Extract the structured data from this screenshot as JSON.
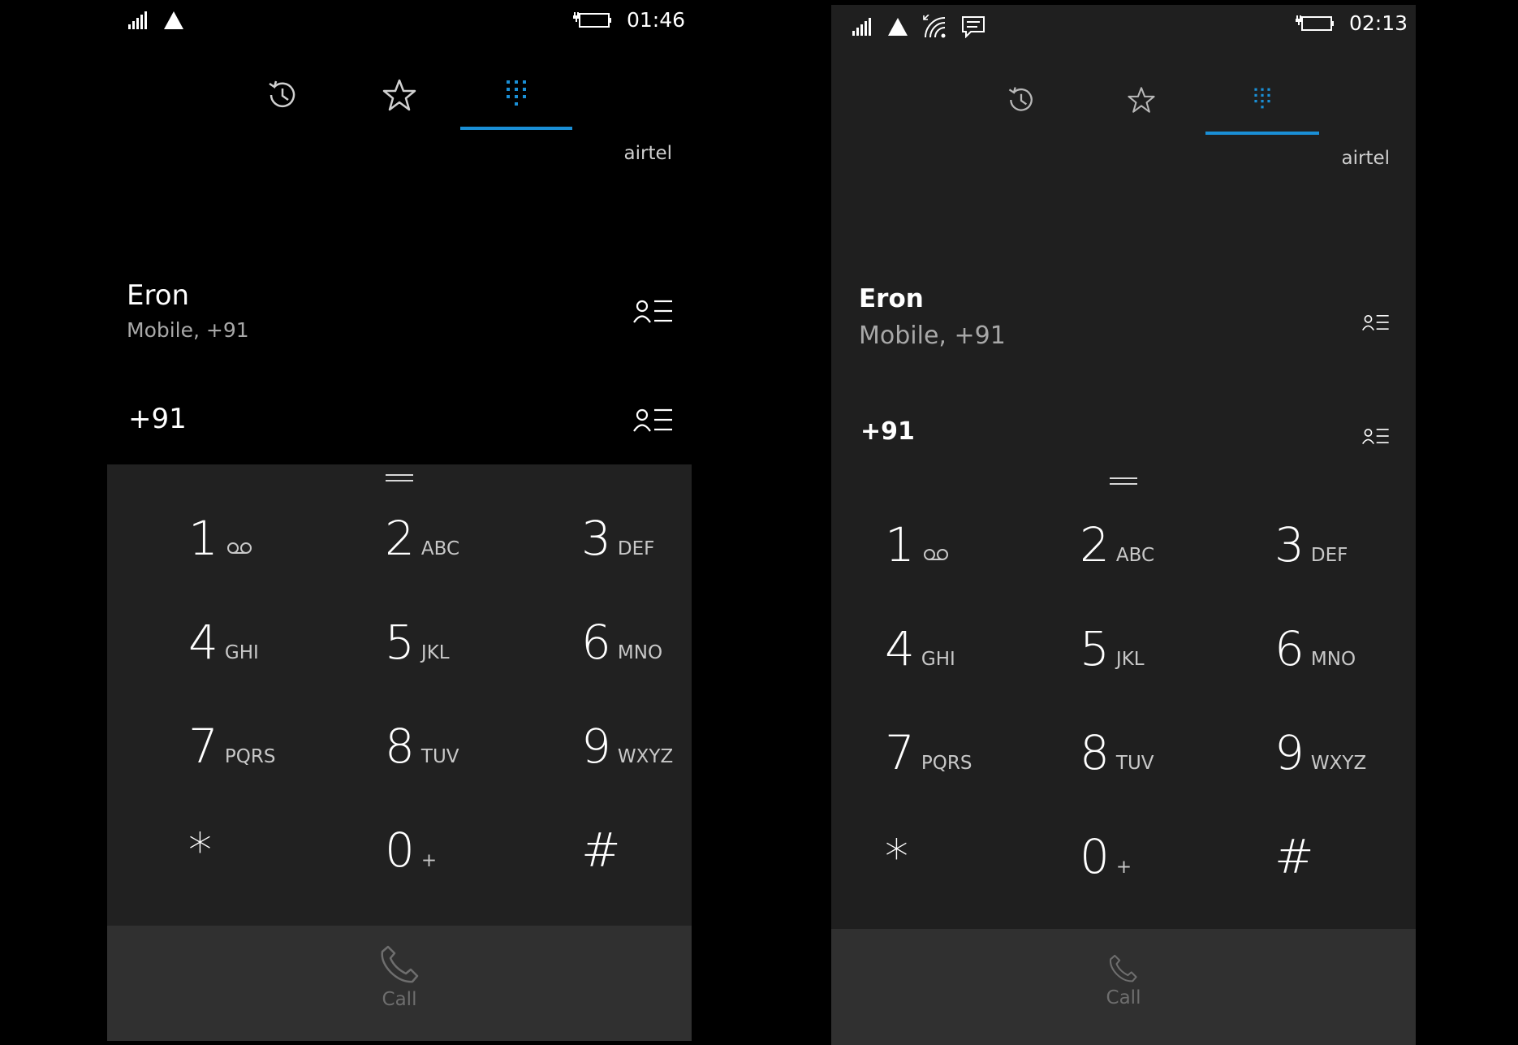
{
  "colors": {
    "accent": "#1a8fd6",
    "left_background": "#000000",
    "right_background": "#1f1f1f",
    "keypad_background": "#212121",
    "callbar_background": "#303030",
    "secondary_text": "#a8a8a8",
    "disabled_text": "#6e6e6e"
  },
  "left": {
    "status": {
      "time": "01:46",
      "icons": [
        "signal-strength-icon",
        "roaming-triangle-icon",
        "battery-charging-icon"
      ]
    },
    "tabs": [
      {
        "name": "history",
        "icon": "history-icon"
      },
      {
        "name": "speed-dial",
        "icon": "star-icon"
      },
      {
        "name": "keypad",
        "icon": "dialpad-icon",
        "selected": true
      }
    ],
    "carrier": "airtel",
    "suggestion": {
      "name": "Eron",
      "detail": "Mobile, +91"
    },
    "entry": {
      "number": "+91"
    },
    "keys": [
      {
        "digit": "1",
        "letters": "",
        "icon": "voicemail-icon"
      },
      {
        "digit": "2",
        "letters": "ABC"
      },
      {
        "digit": "3",
        "letters": "DEF"
      },
      {
        "digit": "4",
        "letters": "GHI"
      },
      {
        "digit": "5",
        "letters": "JKL"
      },
      {
        "digit": "6",
        "letters": "MNO"
      },
      {
        "digit": "7",
        "letters": "PQRS"
      },
      {
        "digit": "8",
        "letters": "TUV"
      },
      {
        "digit": "9",
        "letters": "WXYZ"
      },
      {
        "digit": "*",
        "letters": ""
      },
      {
        "digit": "0",
        "letters": "+"
      },
      {
        "digit": "#",
        "letters": ""
      }
    ],
    "call": {
      "label": "Call",
      "enabled": false
    }
  },
  "right": {
    "status": {
      "time": "02:13",
      "icons": [
        "signal-strength-icon",
        "roaming-triangle-icon",
        "wifi-calling-icon",
        "message-icon",
        "battery-charging-icon"
      ]
    },
    "tabs": [
      {
        "name": "history",
        "icon": "history-icon"
      },
      {
        "name": "speed-dial",
        "icon": "star-icon"
      },
      {
        "name": "keypad",
        "icon": "dialpad-icon",
        "selected": true
      }
    ],
    "carrier": "airtel",
    "suggestion": {
      "name": "Eron",
      "detail": "Mobile, +91"
    },
    "entry": {
      "number": "+91"
    },
    "keys": [
      {
        "digit": "1",
        "letters": "",
        "icon": "voicemail-icon"
      },
      {
        "digit": "2",
        "letters": "ABC"
      },
      {
        "digit": "3",
        "letters": "DEF"
      },
      {
        "digit": "4",
        "letters": "GHI"
      },
      {
        "digit": "5",
        "letters": "JKL"
      },
      {
        "digit": "6",
        "letters": "MNO"
      },
      {
        "digit": "7",
        "letters": "PQRS"
      },
      {
        "digit": "8",
        "letters": "TUV"
      },
      {
        "digit": "9",
        "letters": "WXYZ"
      },
      {
        "digit": "*",
        "letters": ""
      },
      {
        "digit": "0",
        "letters": "+"
      },
      {
        "digit": "#",
        "letters": ""
      }
    ],
    "call": {
      "label": "Call",
      "enabled": false
    }
  }
}
